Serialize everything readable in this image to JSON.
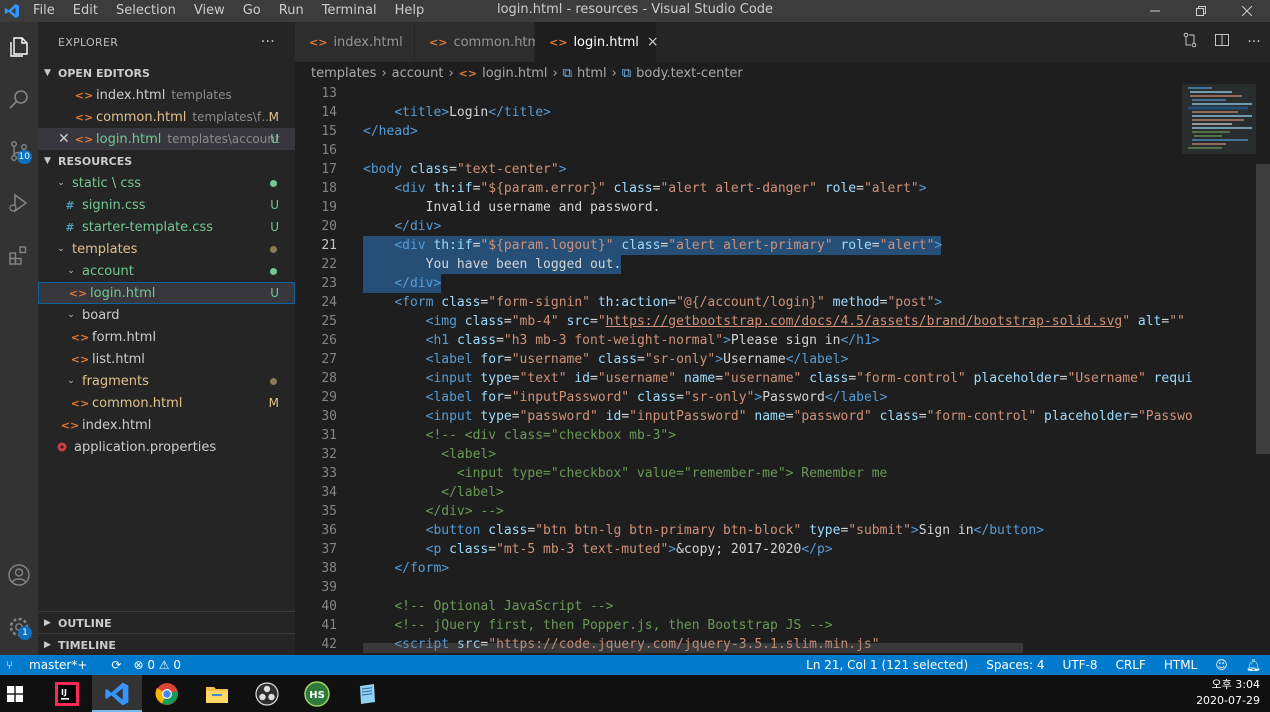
{
  "titlebar": {
    "menu": [
      "File",
      "Edit",
      "Selection",
      "View",
      "Go",
      "Run",
      "Terminal",
      "Help"
    ],
    "title": "login.html - resources - Visual Studio Code"
  },
  "activity": {
    "source_control_badge": "10",
    "settings_badge": "1"
  },
  "sidebar": {
    "title": "EXPLORER",
    "more": "···",
    "open_editors": {
      "label": "OPEN EDITORS",
      "items": [
        {
          "name": "index.html",
          "desc": "templates",
          "status": ""
        },
        {
          "name": "common.html",
          "desc": "templates\\fra...",
          "status": "M"
        },
        {
          "name": "login.html",
          "desc": "templates\\account",
          "status": "U"
        }
      ]
    },
    "resources": {
      "label": "RESOURCES",
      "items": [
        {
          "name": "static \\ css"
        },
        {
          "name": "signin.css",
          "status": "U"
        },
        {
          "name": "starter-template.css",
          "status": "U"
        },
        {
          "name": "templates"
        },
        {
          "name": "account"
        },
        {
          "name": "login.html",
          "status": "U"
        },
        {
          "name": "board"
        },
        {
          "name": "form.html"
        },
        {
          "name": "list.html"
        },
        {
          "name": "fragments"
        },
        {
          "name": "common.html",
          "status": "M"
        },
        {
          "name": "index.html"
        },
        {
          "name": "application.properties"
        }
      ]
    },
    "outline": "OUTLINE",
    "timeline": "TIMELINE"
  },
  "tabs": [
    {
      "label": "index.html"
    },
    {
      "label": "common.html"
    },
    {
      "label": "login.html",
      "close": "×"
    }
  ],
  "breadcrumbs": [
    "templates",
    "account",
    "login.html",
    "html",
    "body.text-center"
  ],
  "editor": {
    "line_numbers": [
      "13",
      "14",
      "15",
      "16",
      "17",
      "18",
      "19",
      "20",
      "21",
      "22",
      "23",
      "24",
      "25",
      "26",
      "27",
      "28",
      "29",
      "30",
      "31",
      "32",
      "33",
      "34",
      "35",
      "36",
      "37",
      "38",
      "39",
      "40",
      "41",
      "42"
    ]
  },
  "statusbar": {
    "branch": "master*+",
    "problems": "⊗ 0 ⚠ 0",
    "position": "Ln 21, Col 1 (121 selected)",
    "spaces": "Spaces: 4",
    "encoding": "UTF-8",
    "eol": "CRLF",
    "language": "HTML"
  },
  "taskbar": {
    "time": "오후 3:04",
    "date": "2020-07-29",
    "hs_label": "HS"
  },
  "colors": {
    "accent": "#007acc",
    "modified": "#e2c08d",
    "untracked": "#73c991",
    "selection": "#264f78"
  }
}
